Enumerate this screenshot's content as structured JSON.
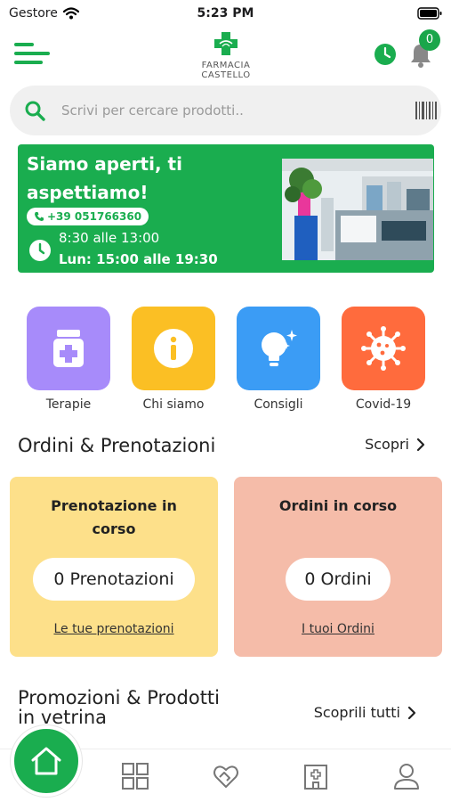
{
  "status_bar": {
    "carrier": "Gestore",
    "time": "5:23 PM"
  },
  "header": {
    "logo_line1": "FARMACIA",
    "logo_line2": "CASTELLO",
    "notification_count": "0"
  },
  "search": {
    "placeholder": "Scrivi per cercare prodotti.."
  },
  "banner": {
    "title": "Siamo aperti, ti aspettiamo!",
    "phone": "+39 051766360",
    "hours_line1": "8:30 alle 13:00",
    "hours_line2": "Lun: 15:00 alle 19:30"
  },
  "shortcuts": [
    {
      "label": "Terapie",
      "color": "#a78bfa",
      "icon": "medicine-jar-icon"
    },
    {
      "label": "Chi siamo",
      "color": "#fbbf24",
      "icon": "info-icon"
    },
    {
      "label": "Consigli",
      "color": "#3b9cf5",
      "icon": "lightbulb-icon"
    },
    {
      "label": "Covid-19",
      "color": "#ff6b3d",
      "icon": "virus-icon"
    }
  ],
  "orders_section": {
    "title": "Ordini & Prenotazioni",
    "more": "Scopri"
  },
  "cards": [
    {
      "title": "Prenotazione in corso",
      "count": "0 Prenotazioni",
      "link": "Le tue prenotazioni",
      "color": "#fde08a"
    },
    {
      "title": "Ordini in corso",
      "count": "0 Ordini",
      "link": "I tuoi Ordini",
      "color": "#f5bca9"
    }
  ],
  "promo_section": {
    "title": "Promozioni & Prodotti in vetrina",
    "more": "Scoprili tutti"
  },
  "tabbar": [
    "home-icon",
    "grid-icon",
    "heart-hand-icon",
    "pharmacy-building-icon",
    "user-icon"
  ],
  "colors": {
    "brand_green": "#1aad4f"
  }
}
